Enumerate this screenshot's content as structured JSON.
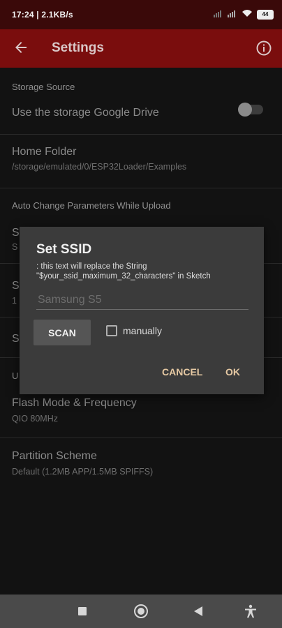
{
  "status": {
    "time_speed": "17:24 | 2.1KB/s",
    "battery": "44"
  },
  "appbar": {
    "title": "Settings"
  },
  "settings": {
    "storage_section": "Storage Source",
    "google_drive_label": "Use the storage Google Drive",
    "google_drive_enabled": false,
    "home_folder_title": "Home Folder",
    "home_folder_path": "/storage/emulated/0/ESP32Loader/Examples",
    "auto_section": "Auto Change Parameters While Upload",
    "partial_rows": [
      {
        "title_letter": "S",
        "summary_letter": "S"
      },
      {
        "title_letter": "S",
        "summary_letter": "1"
      },
      {
        "title_letter": "S"
      }
    ],
    "upload_section_letter": "U",
    "flash_title": "Flash Mode & Frequency",
    "flash_value": "QIO 80MHz",
    "partition_title": "Partition Scheme",
    "partition_value": "Default (1.2MB APP/1.5MB SPIFFS)"
  },
  "dialog": {
    "title": "Set SSID",
    "description": ": this text will replace the String \"$your_ssid_maximum_32_characters\" in Sketch",
    "input_placeholder": "Samsung S5",
    "input_value": "",
    "scan_label": "SCAN",
    "manual_label": "manually",
    "manual_checked": false,
    "cancel_label": "CANCEL",
    "ok_label": "OK"
  },
  "colors": {
    "appbar": "#7a0d0d",
    "statusbar": "#3a0909",
    "accent_text": "#e6c9a3",
    "dialog_bg": "#3b3b3b"
  },
  "icons": [
    "back-arrow-icon",
    "info-icon",
    "wifi-icon",
    "signal-icon",
    "battery-icon",
    "nav-square-icon",
    "nav-home-icon",
    "nav-back-icon",
    "accessibility-icon"
  ]
}
